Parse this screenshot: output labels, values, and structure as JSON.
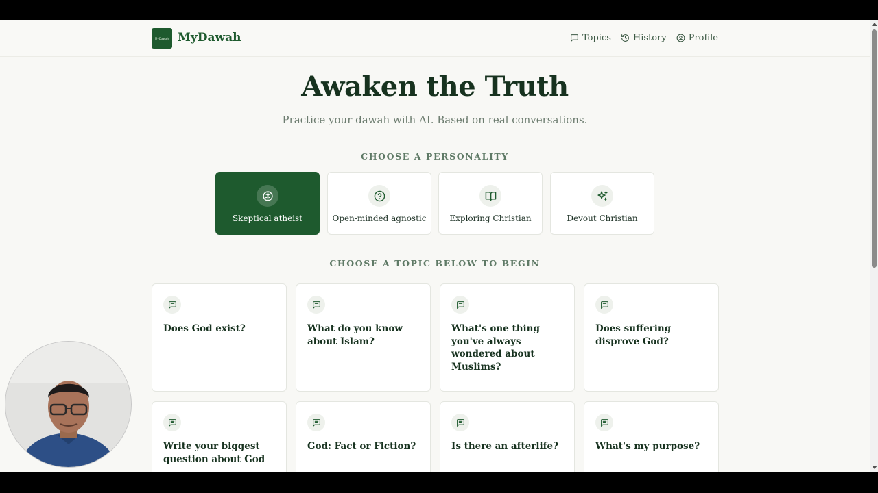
{
  "app": {
    "brand": "MyDawah",
    "logo_text": "MyDawah"
  },
  "nav": [
    {
      "label": "Topics",
      "icon": "message-square-icon"
    },
    {
      "label": "History",
      "icon": "history-icon"
    },
    {
      "label": "Profile",
      "icon": "user-circle-icon"
    }
  ],
  "hero": {
    "title": "Awaken the Truth",
    "subtitle": "Practice your dawah with AI. Based on real conversations."
  },
  "personality": {
    "heading": "CHOOSE A PERSONALITY",
    "selected_index": 0,
    "options": [
      {
        "label": "Skeptical atheist",
        "icon": "brain-icon"
      },
      {
        "label": "Open-minded agnostic",
        "icon": "question-circle-icon"
      },
      {
        "label": "Exploring Christian",
        "icon": "book-open-icon"
      },
      {
        "label": "Devout Christian",
        "icon": "sparkles-icon"
      }
    ]
  },
  "topics": {
    "heading": "CHOOSE A TOPIC BELOW TO BEGIN",
    "items": [
      {
        "title": "Does God exist?"
      },
      {
        "title": "What do you know about Islam?"
      },
      {
        "title": "What's one thing you've always wondered about Muslims?"
      },
      {
        "title": "Does suffering disprove God?"
      },
      {
        "title": "Write your biggest question about God"
      },
      {
        "title": "God: Fact or Fiction?"
      },
      {
        "title": "Is there an afterlife?"
      },
      {
        "title": "What's my purpose?"
      }
    ]
  },
  "colors": {
    "accent": "#1e5a2e",
    "background": "#f8f8f5",
    "text": "#17321f",
    "muted": "#6c7c6f"
  }
}
